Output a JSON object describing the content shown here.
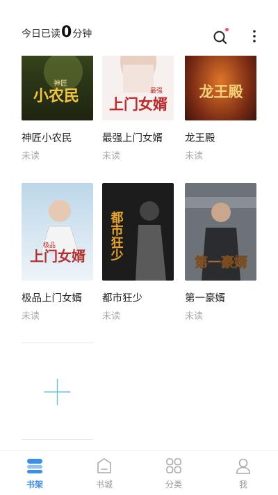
{
  "header": {
    "read_prefix": "今日已读",
    "read_minutes": "0",
    "read_suffix": "分钟",
    "search_icon": "search-icon",
    "more_icon": "more-vertical-icon",
    "notification_dot_color": "#f0506e"
  },
  "books": [
    {
      "title": "神匠小农民",
      "status": "未读",
      "cover_text": "小农民",
      "cover_subtext": "神匠"
    },
    {
      "title": "最强上门女婿",
      "status": "未读",
      "cover_text": "上门女婿",
      "cover_subtext": "最强"
    },
    {
      "title": "龙王殿",
      "status": "未读",
      "cover_text": "龙王殿",
      "cover_subtext": ""
    },
    {
      "title": "极品上门女婿",
      "status": "未读",
      "cover_text": "上门女婿",
      "cover_subtext": "极品"
    },
    {
      "title": "都市狂少",
      "status": "未读",
      "cover_text": "都市狂少",
      "cover_subtext": ""
    },
    {
      "title": "第一豪婿",
      "status": "未读",
      "cover_text": "第一豪婿",
      "cover_subtext": ""
    }
  ],
  "add_book_icon": "plus-icon",
  "nav": {
    "items": [
      {
        "label": "书架",
        "icon": "bookshelf-icon",
        "active": true
      },
      {
        "label": "书城",
        "icon": "bookstore-icon",
        "active": false
      },
      {
        "label": "分类",
        "icon": "category-icon",
        "active": false
      },
      {
        "label": "我",
        "icon": "profile-icon",
        "active": false
      }
    ],
    "active_color": "#3a8fe6",
    "inactive_color": "#999999"
  }
}
